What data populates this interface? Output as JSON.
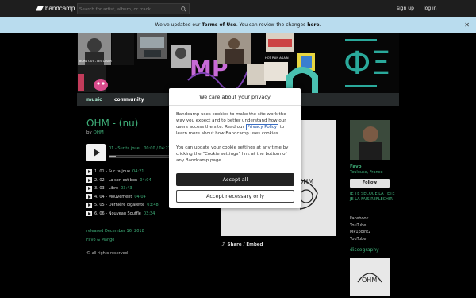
{
  "topbar": {
    "logo_text": "bandcamp",
    "search_placeholder": "Search for artist, album, or track",
    "signup": "sign up",
    "login": "log in"
  },
  "notice": {
    "prefix": "We've updated our ",
    "terms": "Terms of Use",
    "middle": ". You can review the changes ",
    "here": "here",
    "suffix": ".",
    "close": "✕"
  },
  "banner": {
    "tile1_text": "BURN OUT - LES LASERS",
    "tile2_text": "HOT PAIN AGAIN",
    "mp_text": "MP",
    "dot_text": "ФΞ"
  },
  "nav": {
    "music": "music",
    "community": "community"
  },
  "album": {
    "title": "OHM - (nu)",
    "by": "by",
    "artist": "OHM",
    "now_playing": "01 - Sur ta joue",
    "time": "00:00 / 04:21",
    "released": "released December 16, 2018",
    "credit": "Favo & Mango",
    "rights": "all rights reserved",
    "rights_icon": "©",
    "tracks": [
      {
        "num": "1.",
        "title": "01 - Sur ta joue",
        "dur": "04:21"
      },
      {
        "num": "2.",
        "title": "02 - La son est bon",
        "dur": "04:04"
      },
      {
        "num": "3.",
        "title": "03 - Libre",
        "dur": "03:43"
      },
      {
        "num": "4.",
        "title": "04 - Mouvement",
        "dur": "04:04"
      },
      {
        "num": "5.",
        "title": "05 - Dernière cigarette",
        "dur": "03:48"
      },
      {
        "num": "6.",
        "title": "06 - Nouveau Souffle",
        "dur": "03:34"
      }
    ],
    "share_label": "Share / Embed",
    "art_text": "OHM"
  },
  "sidebar": {
    "name": "Favo",
    "location": "Toulouse, France",
    "follow": "Follow",
    "bio_line1": "JE TE SECOUE LA TETE",
    "bio_line2": "JE LA FAIS REFLECHIR",
    "links": [
      "Facebook",
      "YouTube",
      "MP1point2",
      "YouTube"
    ],
    "discography": "discography",
    "disco_art_text": "OHM"
  },
  "modal": {
    "title": "We care about your privacy",
    "p1_before": "Bandcamp uses cookies to make the site work the way you expect and to better understand how our users access the site. Read our ",
    "privacy_link": "Privacy Policy",
    "p1_after": " to learn more about how Bandcamp uses cookies.",
    "p2": "You can update your cookie settings at any time by clicking the “Cookie settings” link at the bottom of any Bandcamp page.",
    "accept_all": "Accept all",
    "accept_necessary": "Accept necessary only"
  },
  "colors": {
    "accent": "#3fb07a",
    "notice_bg": "#b9dcee",
    "topbar_bg": "#1e1e1e"
  }
}
